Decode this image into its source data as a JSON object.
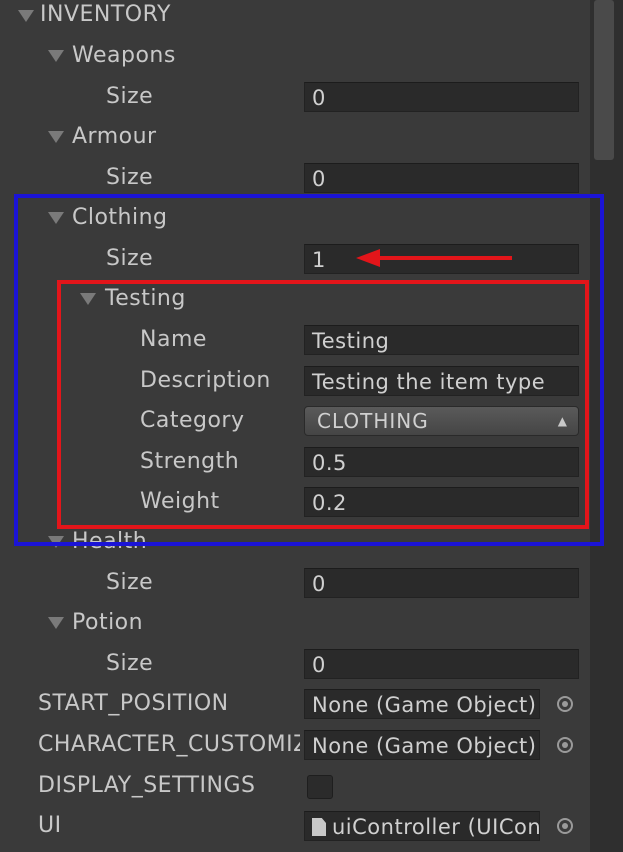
{
  "colors": {
    "background": "#3a3a3a",
    "field_bg": "#2a2a2a",
    "label": "#c8c8c8",
    "highlight_blue": "#1b14d6",
    "highlight_red": "#e3151a"
  },
  "inventory": {
    "label": "INVENTORY",
    "weapons": {
      "label": "Weapons",
      "size_label": "Size",
      "size_value": "0"
    },
    "armour": {
      "label": "Armour",
      "size_label": "Size",
      "size_value": "0"
    },
    "clothing": {
      "label": "Clothing",
      "size_label": "Size",
      "size_value": "1",
      "item": {
        "label": "Testing",
        "name_label": "Name",
        "name_value": "Testing",
        "description_label": "Description",
        "description_value": "Testing the item type",
        "category_label": "Category",
        "category_value": "CLOTHING",
        "strength_label": "Strength",
        "strength_value": "0.5",
        "weight_label": "Weight",
        "weight_value": "0.2"
      }
    },
    "health": {
      "label": "Health",
      "size_label": "Size",
      "size_value": "0"
    },
    "potion": {
      "label": "Potion",
      "size_label": "Size",
      "size_value": "0"
    }
  },
  "start_position": {
    "label": "START_POSITION",
    "value": "None (Game Object)"
  },
  "character_custom": {
    "label": "CHARACTER_CUSTOMIZATION",
    "value": "None (Game Object)"
  },
  "display_settings": {
    "label": "DISPLAY_SETTINGS",
    "checked": false
  },
  "ui": {
    "label": "UI",
    "value": "uiController (UIController)"
  },
  "icons": {
    "foldout": "triangle-down-icon",
    "object_picker": "object-picker-icon",
    "script_file": "script-file-icon",
    "dropdown": "updown-arrows-icon"
  }
}
